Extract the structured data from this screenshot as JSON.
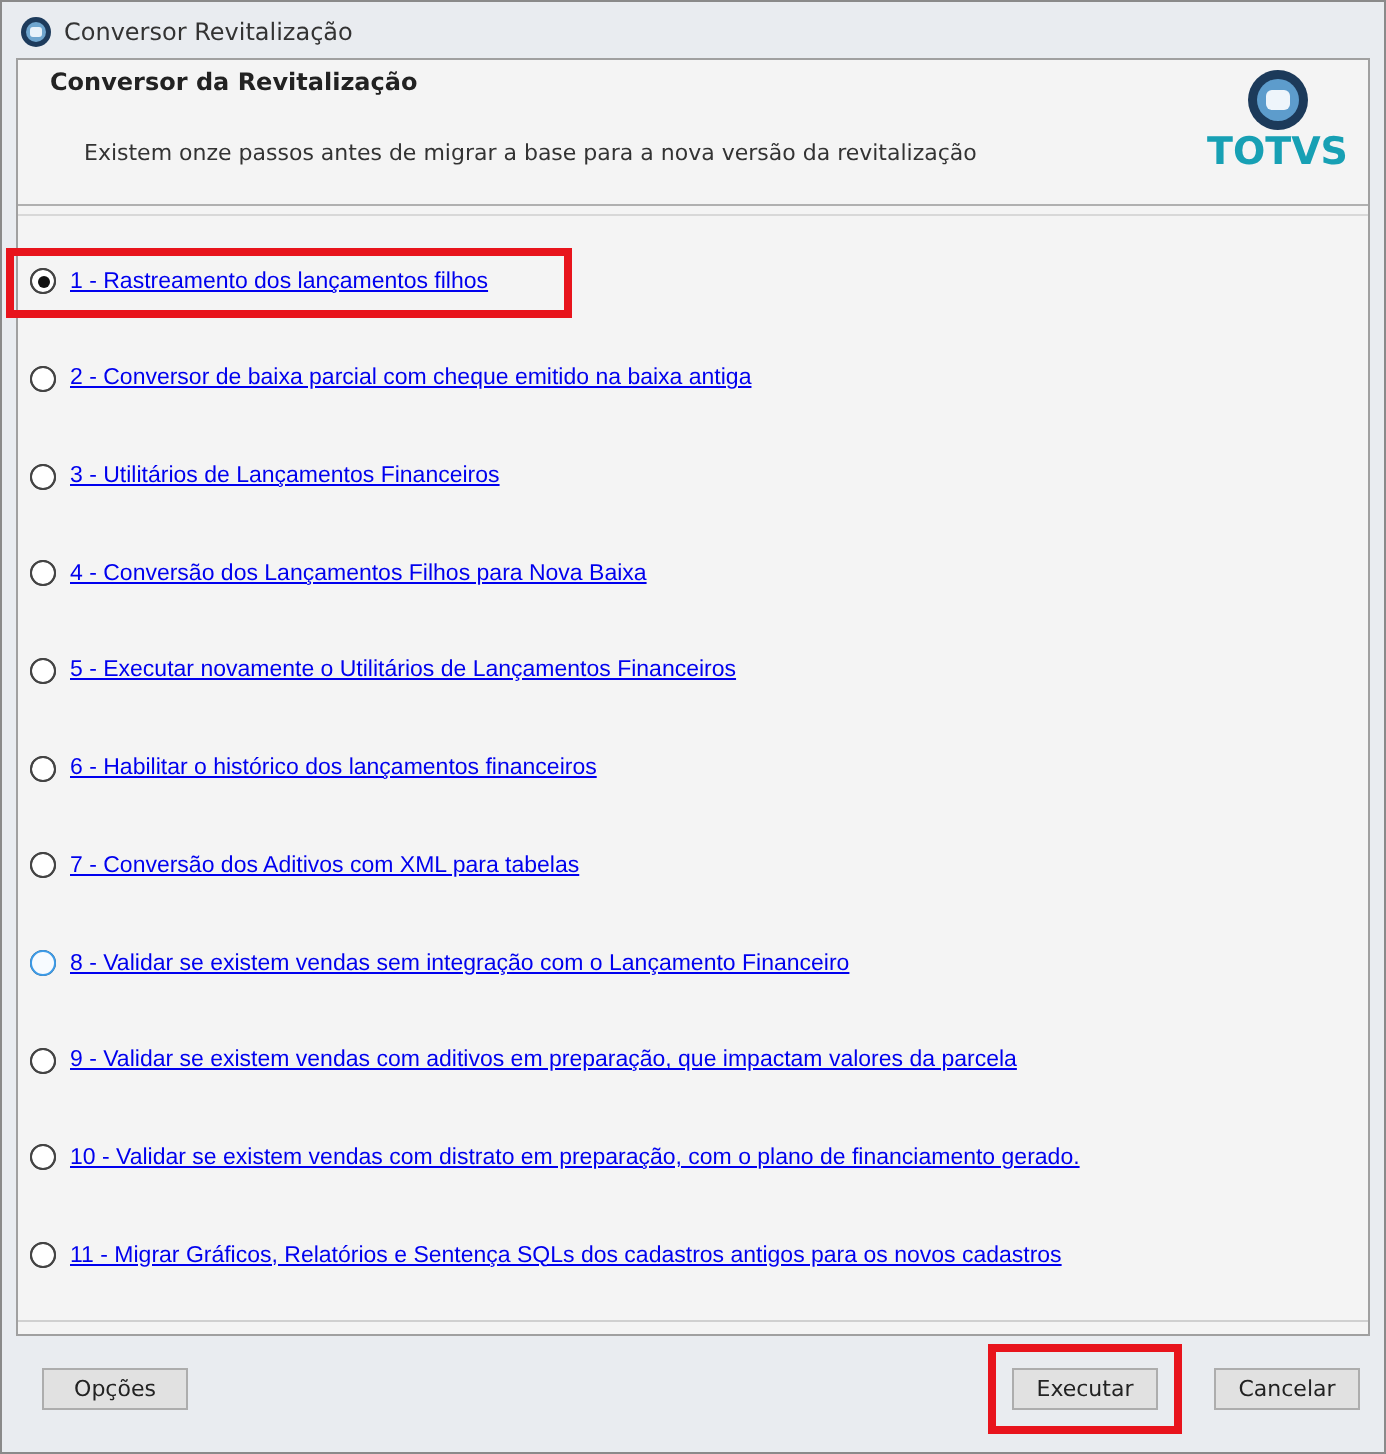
{
  "window": {
    "title": "Conversor Revitalização"
  },
  "header": {
    "title": "Conversor da Revitalização",
    "subtitle": "Existem onze passos antes de migrar a base para a nova versão da revitalização",
    "logo_text": "TOTVS"
  },
  "options": [
    {
      "label": "1 - Rastreamento dos lançamentos filhos",
      "selected": true,
      "focused": false,
      "highlighted": true
    },
    {
      "label": "2 - Conversor de baixa parcial com cheque emitido na baixa antiga",
      "selected": false,
      "focused": false,
      "highlighted": false
    },
    {
      "label": "3 - Utilitários de Lançamentos Financeiros",
      "selected": false,
      "focused": false,
      "highlighted": false
    },
    {
      "label": "4 - Conversão dos Lançamentos Filhos para Nova Baixa",
      "selected": false,
      "focused": false,
      "highlighted": false
    },
    {
      "label": "5 - Executar novamente o Utilitários de Lançamentos Financeiros",
      "selected": false,
      "focused": false,
      "highlighted": false
    },
    {
      "label": "6 - Habilitar o histórico dos lançamentos financeiros",
      "selected": false,
      "focused": false,
      "highlighted": false
    },
    {
      "label": "7 - Conversão dos Aditivos com XML para tabelas",
      "selected": false,
      "focused": false,
      "highlighted": false
    },
    {
      "label": "8 - Validar se existem vendas sem integração com o Lançamento Financeiro",
      "selected": false,
      "focused": true,
      "highlighted": false
    },
    {
      "label": "9 - Validar se existem vendas com aditivos em preparação, que impactam valores da parcela",
      "selected": false,
      "focused": false,
      "highlighted": false
    },
    {
      "label": "10 - Validar se existem vendas com distrato em preparação, com o plano de financiamento gerado.",
      "selected": false,
      "focused": false,
      "highlighted": false
    },
    {
      "label": "11 - Migrar Gráficos, Relatórios e Sentença SQLs dos cadastros antigos para os novos cadastros",
      "selected": false,
      "focused": false,
      "highlighted": false
    }
  ],
  "buttons": [
    {
      "label": "Opções",
      "kind": "left",
      "highlighted": false
    },
    {
      "label": "Executar",
      "kind": "right",
      "highlighted": true
    },
    {
      "label": "Cancelar",
      "kind": "right",
      "highlighted": false
    }
  ]
}
